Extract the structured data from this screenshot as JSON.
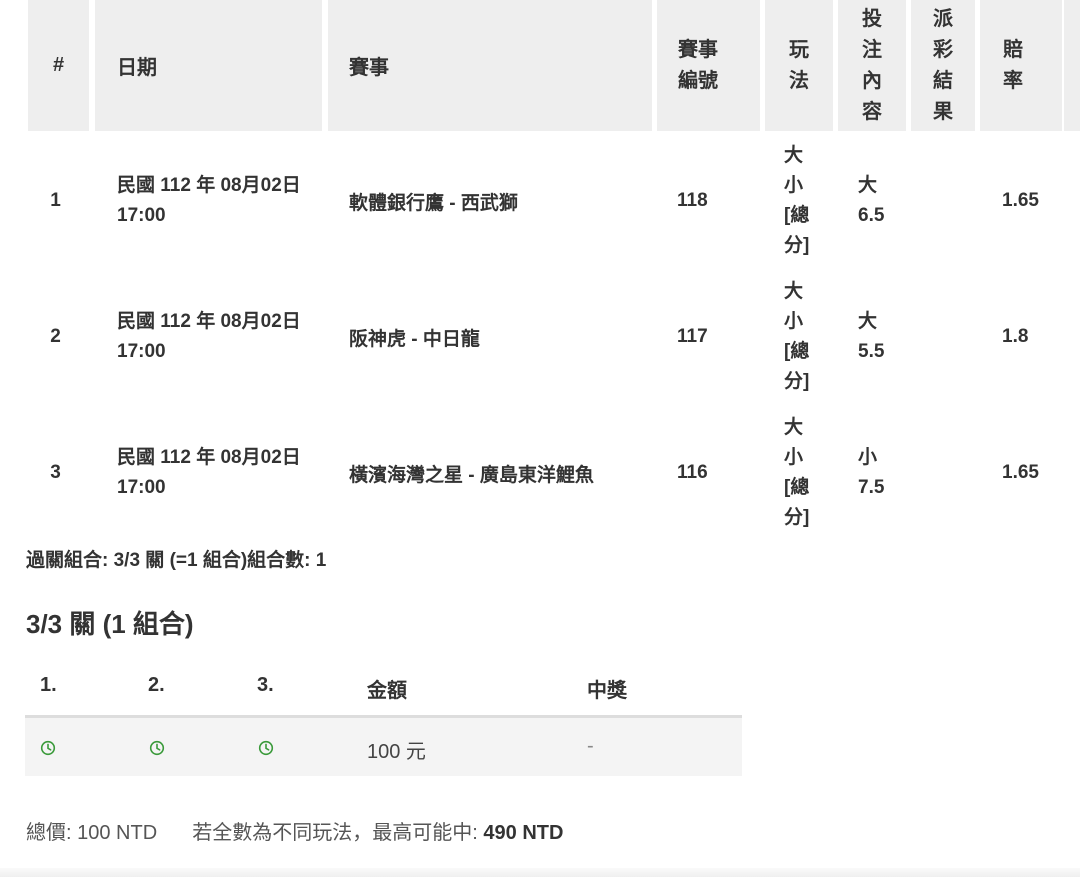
{
  "table": {
    "headers": {
      "num": "#",
      "date": "日期",
      "event": "賽事",
      "event_no": "賽事編號",
      "play": "玩法",
      "bet": "投注內容",
      "result": "派彩結果",
      "odds": "賠率"
    },
    "rows": [
      {
        "num": "1",
        "date": "民國 112 年 08月02日 17:00",
        "event": "軟體銀行鷹 - 西武獅",
        "event_no": "118",
        "play": "大小[總分]",
        "bet_side": "大",
        "bet_line": "6.5",
        "result": "",
        "odds": "1.65"
      },
      {
        "num": "2",
        "date": "民國 112 年 08月02日 17:00",
        "event": "阪神虎 - 中日龍",
        "event_no": "117",
        "play": "大小[總分]",
        "bet_side": "大",
        "bet_line": "5.5",
        "result": "",
        "odds": "1.8"
      },
      {
        "num": "3",
        "date": "民國 112 年 08月02日 17:00",
        "event": "橫濱海灣之星 - 廣島東洋鯉魚",
        "event_no": "116",
        "play": "大小[總分]",
        "bet_side": "小",
        "bet_line": "7.5",
        "result": "",
        "odds": "1.65"
      }
    ]
  },
  "summary": "過關組合: 3/3 關 (=1 組合)組合數: 1",
  "combo": {
    "title": "3/3 關 (1 組合)",
    "headers": {
      "c1": "1.",
      "c2": "2.",
      "c3": "3.",
      "amount": "金額",
      "win": "中獎"
    },
    "row": {
      "icon1": "clock-icon",
      "icon2": "clock-icon",
      "icon3": "clock-icon",
      "amount": "100 元",
      "win": "-"
    },
    "icon_color": "#3a9a3a"
  },
  "total": {
    "label": "總價:",
    "value": "100 NTD",
    "max_label": "若全數為不同玩法，最高可能中:",
    "max_value": "490 NTD"
  }
}
